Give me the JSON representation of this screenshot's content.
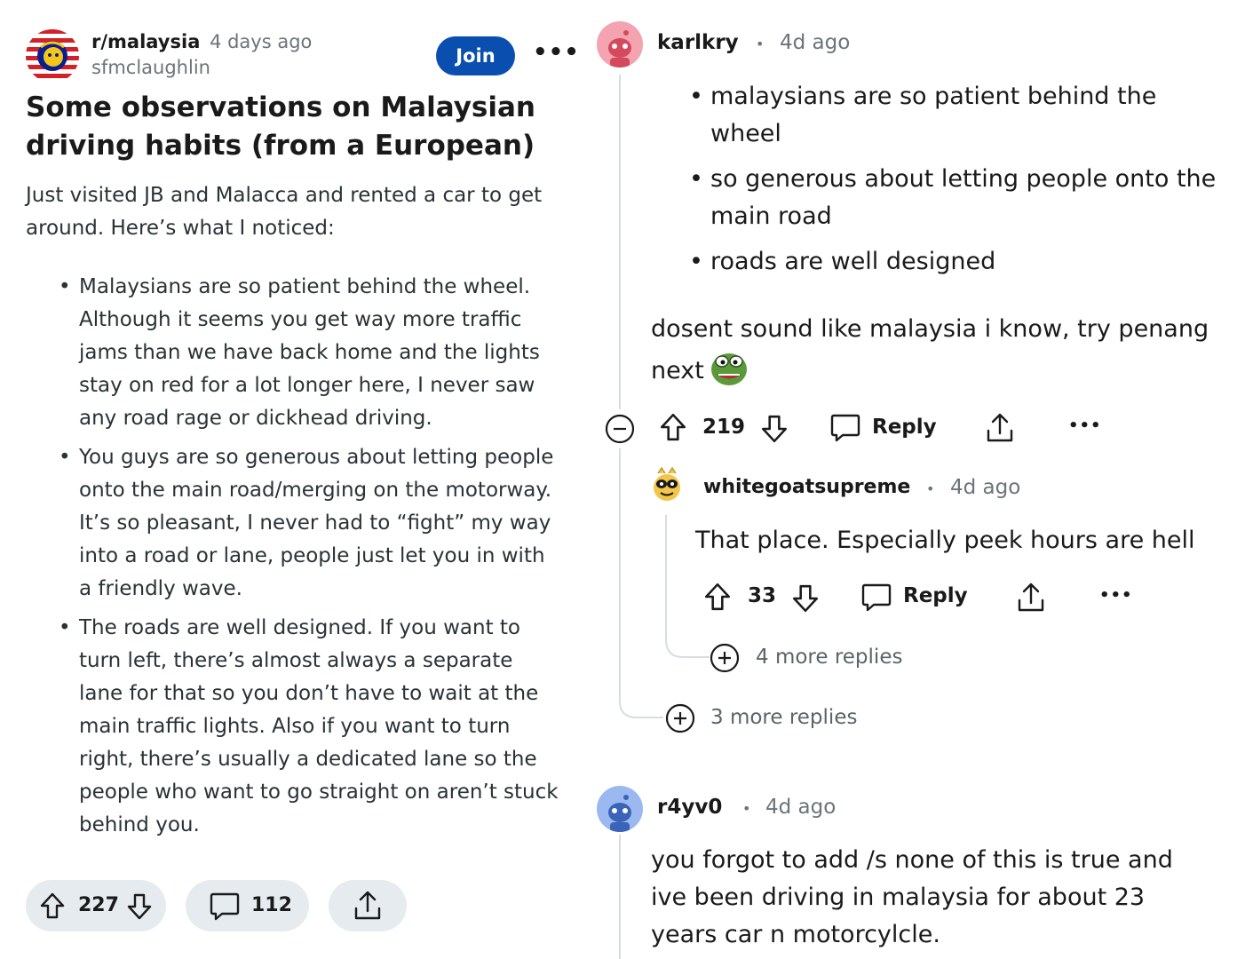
{
  "post": {
    "subreddit": "r/malaysia",
    "time": "4 days ago",
    "author": "sfmclaughlin",
    "join_label": "Join",
    "more_label": "•••",
    "title": "Some observations on Malaysian driving habits (from a European)",
    "intro": "Just visited JB and Malacca and rented a car to get around. Here’s what I noticed:",
    "bullets": [
      "Malaysians are so patient behind the wheel. Although it seems you get way more traffic jams than we have back home and the lights stay on red for a lot longer here, I never saw any road rage or dickhead driving.",
      "You guys are so generous about letting people onto the main road/merging on the motorway. It’s so pleasant, I never had to “fight” my way into a road or lane, people just let you in with a friendly wave.",
      "The roads are well designed. If you want to turn left, there’s almost always a separate lane for that so you don’t have to wait at the main traffic lights. Also if you want to turn right, there’s usually a dedicated lane so the people who want to go straight on aren’t stuck behind you."
    ],
    "votes": "227",
    "comments": "112"
  },
  "comments": {
    "c1": {
      "user": "karlkry",
      "sep": "•",
      "time": "4d ago",
      "quote_bullets": [
        "malaysians are so patient behind the wheel",
        "so generous about letting people onto the main road",
        "roads are well designed"
      ],
      "text_line1": "dosent sound like malaysia i know, try penang",
      "text_line2": "next",
      "votes": "219",
      "reply_label": "Reply",
      "more_label": "•••"
    },
    "c2": {
      "user": "whitegoatsupreme",
      "sep": "•",
      "time": "4d ago",
      "text": "That place. Especially peek hours are hell",
      "votes": "33",
      "reply_label": "Reply",
      "more_label": "•••",
      "more_replies": "4 more replies"
    },
    "c1_more_replies": "3 more replies",
    "c3": {
      "user": "r4yv0",
      "sep": "•",
      "time": "4d ago",
      "text": "you forgot to add /s none of this is true and ive been driving in malaysia for about 23 years car n motorcylcle."
    }
  },
  "colors": {
    "join_button": "#0a4fb0",
    "pill_bg": "#e5ebee",
    "avatar_pink": "#f4a3b0",
    "avatar_blue": "#9bb8f0",
    "meta_gray": "#6b7479"
  },
  "icons": [
    "subreddit-flag-icon",
    "upvote-icon",
    "downvote-icon",
    "comment-icon",
    "share-icon",
    "collapse-icon",
    "expand-icon",
    "pepe-emote-icon"
  ]
}
